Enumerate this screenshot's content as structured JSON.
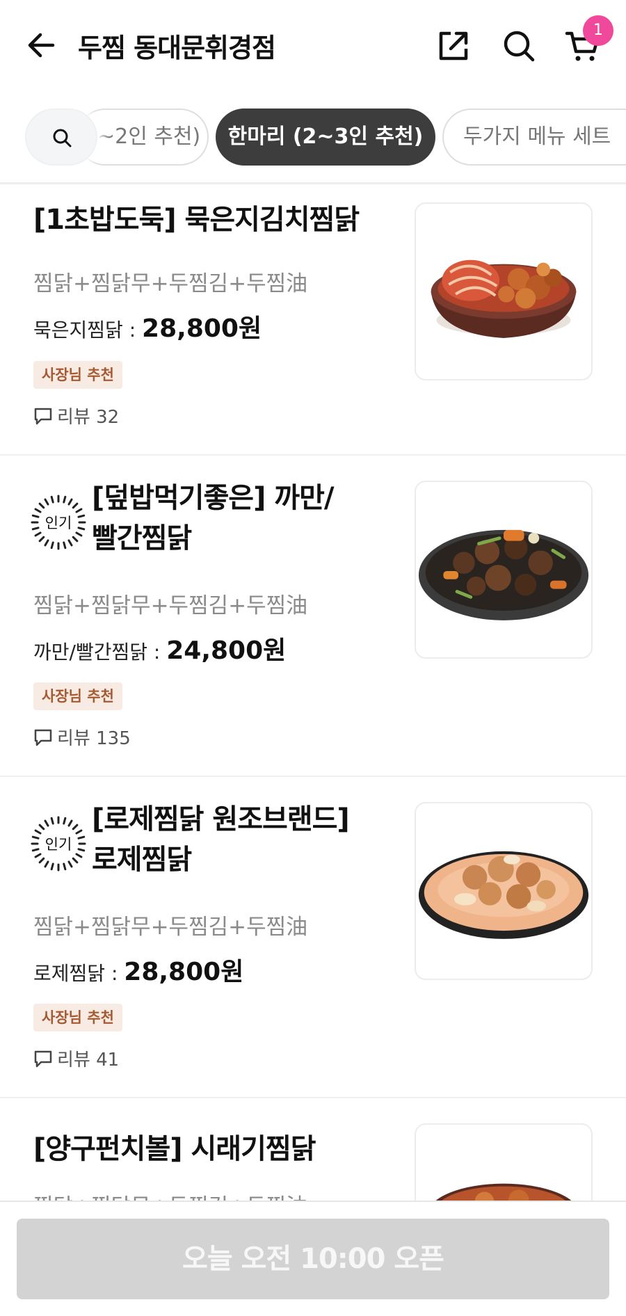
{
  "header": {
    "title": "두찜 동대문휘경점",
    "cart_count": "1"
  },
  "categories": {
    "prev_label": "~2인 추천)",
    "active_label": "한마리 (2~3인 추천)",
    "next_label": "두가지 메뉴 세트"
  },
  "menu_items": [
    {
      "name": "[1초밥도둑] 묵은지김치찜닭",
      "popular_badge": "",
      "description": "찜닭+찜닭무+두찜김+두찜油",
      "price_label": "묵은지찜닭 : ",
      "price": "28,800원",
      "tag": "사장님 추천",
      "reviews": "리뷰 32"
    },
    {
      "name": "[덮밥먹기좋은] 까만/빨간찜닭",
      "popular_badge": "인기",
      "description": "찜닭+찜닭무+두찜김+두찜油",
      "price_label": "까만/빨간찜닭 : ",
      "price": "24,800원",
      "tag": "사장님 추천",
      "reviews": "리뷰 135"
    },
    {
      "name": "[로제찜닭 원조브랜드] 로제찜닭",
      "popular_badge": "인기",
      "description": "찜닭+찜닭무+두찜김+두찜油",
      "price_label": "로제찜닭 : ",
      "price": "28,800원",
      "tag": "사장님 추천",
      "reviews": "리뷰 41"
    },
    {
      "name": "[양구펀치볼] 시래기찜닭",
      "popular_badge": "",
      "description": "찜닭+찜닭무+두찜김+두찜油"
    }
  ],
  "bottom": {
    "open_button": "오늘 오전 10:00 오픈"
  },
  "colors": {
    "badge_pink": "#f0489a",
    "active_chip": "#3d3d3d",
    "owner_tag_bg": "#f7ebe3",
    "owner_tag_text": "#a65a33",
    "disabled_button": "#d3d3d3"
  },
  "icons": [
    "back-arrow-icon",
    "share-icon",
    "search-icon",
    "cart-icon",
    "popular-badge-icon",
    "review-speech-icon"
  ]
}
